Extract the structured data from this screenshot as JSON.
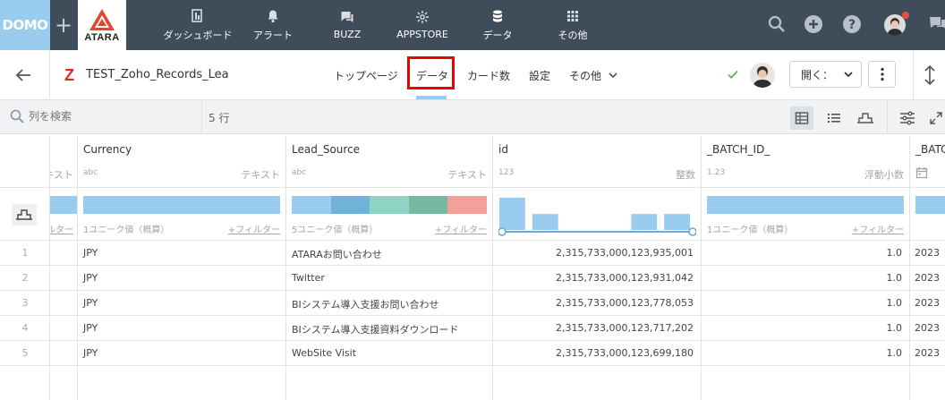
{
  "topbar": {
    "domo_logo": "DOMO",
    "plus": "+",
    "atara_logo": "ATARA",
    "nav": [
      {
        "label": "ダッシュボード",
        "icon": "dashboard-icon"
      },
      {
        "label": "アラート",
        "icon": "bell-icon"
      },
      {
        "label": "BUZZ",
        "icon": "chat-icon"
      },
      {
        "label": "APPSTORE",
        "icon": "appstore-icon"
      },
      {
        "label": "データ",
        "icon": "database-icon"
      },
      {
        "label": "その他",
        "icon": "grid-icon"
      }
    ],
    "colors": {
      "bg": "#3f4c5a",
      "domo": "#99ccee",
      "notification": "#e84c3d"
    }
  },
  "subbar": {
    "dataset_name": "TEST_Zoho_Records_Leads",
    "tabs": [
      "トップページ",
      "データ",
      "カード数",
      "設定",
      "その他"
    ],
    "active_tab": "データ",
    "open_button": "開く：",
    "status_icon": "check-icon"
  },
  "toolbar": {
    "search_placeholder": "列を検索",
    "row_count": "5 行"
  },
  "columns": [
    {
      "name": "",
      "type_badge": "",
      "type_name": "キスト",
      "unique": "",
      "filter": "ルター"
    },
    {
      "name": "Currency",
      "type_badge": "abc",
      "type_name": "テキスト",
      "unique": "1ユニーク値（概算）",
      "filter": "+フィルター"
    },
    {
      "name": "Lead_Source",
      "type_badge": "abc",
      "type_name": "テキスト",
      "unique": "5ユニーク値（概算）",
      "filter": "+フィルター"
    },
    {
      "name": "id",
      "type_badge": "123",
      "type_name": "整数",
      "unique": "",
      "filter": ""
    },
    {
      "name": "_BATCH_ID_",
      "type_badge": "1.23",
      "type_name": "浮動小数",
      "unique": "1ユニーク値（概算）",
      "filter": "+フィルター"
    },
    {
      "name": "_BATC",
      "type_badge": "",
      "type_name": "",
      "unique": "",
      "filter": ""
    }
  ],
  "rows": [
    {
      "num": "1",
      "currency": "JPY",
      "lead_source": "ATARAお問い合わせ",
      "id": "2,315,733,000,123,935,001",
      "batch_id": "1.0",
      "batch_ts": "2023"
    },
    {
      "num": "2",
      "currency": "JPY",
      "lead_source": "Twitter",
      "id": "2,315,733,000,123,931,042",
      "batch_id": "1.0",
      "batch_ts": "2023"
    },
    {
      "num": "3",
      "currency": "JPY",
      "lead_source": "BIシステム導入支援お問い合わせ",
      "id": "2,315,733,000,123,778,053",
      "batch_id": "1.0",
      "batch_ts": "2023"
    },
    {
      "num": "4",
      "currency": "JPY",
      "lead_source": "BIシステム導入支援資料ダウンロード",
      "id": "2,315,733,000,123,717,202",
      "batch_id": "1.0",
      "batch_ts": "2023"
    },
    {
      "num": "5",
      "currency": "JPY",
      "lead_source": "WebSite Visit",
      "id": "2,315,733,000,123,699,180",
      "batch_id": "1.0",
      "batch_ts": "2023"
    }
  ],
  "profile_colors": [
    "#6fb3d9",
    "#8ed3c4",
    "#76b9a3",
    "#f4a09a"
  ],
  "id_histogram": [
    0.95,
    0.47,
    0.0,
    0.0,
    0.47,
    0.47
  ]
}
